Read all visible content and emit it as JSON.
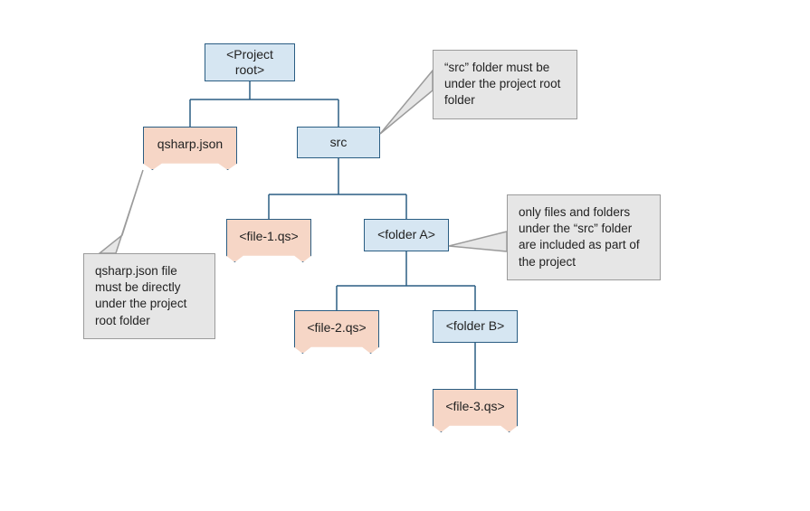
{
  "nodes": {
    "projectRoot": "<Project root>",
    "qsharpJson": "qsharp.json",
    "src": "src",
    "file1": "<file-1.qs>",
    "folderA": "<folder A>",
    "file2": "<file-2.qs>",
    "folderB": "<folder B>",
    "file3": "<file-3.qs>"
  },
  "callouts": {
    "qsharpNote": "qsharp.json file must be directly under the project root folder",
    "srcNote": "“src” folder must be under the project root folder",
    "folderNote": "only files and folders under the “src” folder are included as part of the project"
  }
}
